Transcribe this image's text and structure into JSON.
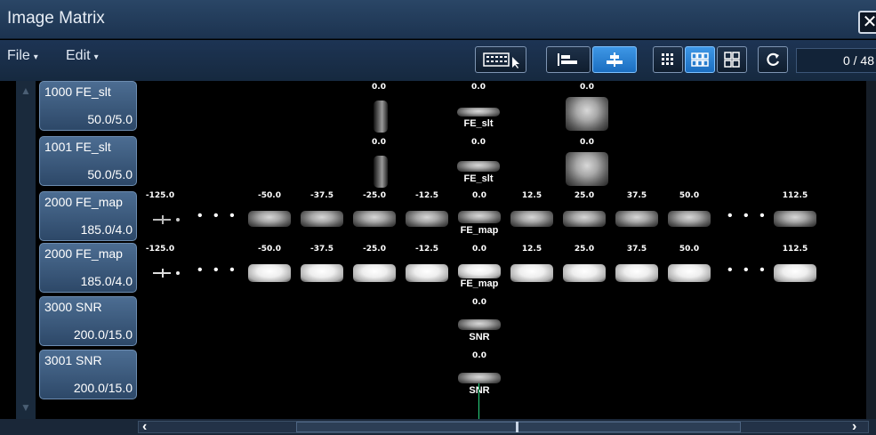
{
  "window": {
    "title": "Image Matrix",
    "close_label": "✕"
  },
  "menus": [
    {
      "label": "File"
    },
    {
      "label": "Edit"
    }
  ],
  "counter": "0 / 48",
  "series": [
    {
      "name": "1000 FE_slt",
      "sub": "50.0/5.0"
    },
    {
      "name": "1001 FE_slt",
      "sub": "50.0/5.0"
    },
    {
      "name": "2000 FE_map",
      "sub": "185.0/4.0"
    },
    {
      "name": "2000 FE_map",
      "sub": "185.0/4.0"
    },
    {
      "name": "3000 SNR",
      "sub": "200.0/15.0"
    },
    {
      "name": "3001 SNR",
      "sub": "200.0/15.0"
    }
  ],
  "rows": {
    "slt_labels": [
      "0.0",
      "0.0",
      "0.0"
    ],
    "slt_tag": "FE_slt",
    "map_labels": [
      "-125.0",
      "-50.0",
      "-37.5",
      "-25.0",
      "-12.5",
      "0.0",
      "12.5",
      "25.0",
      "37.5",
      "50.0",
      "112.5"
    ],
    "map_tag": "FE_map",
    "snr_label": "0.0",
    "snr_tag": "SNR"
  },
  "ellipsis": "• • •"
}
